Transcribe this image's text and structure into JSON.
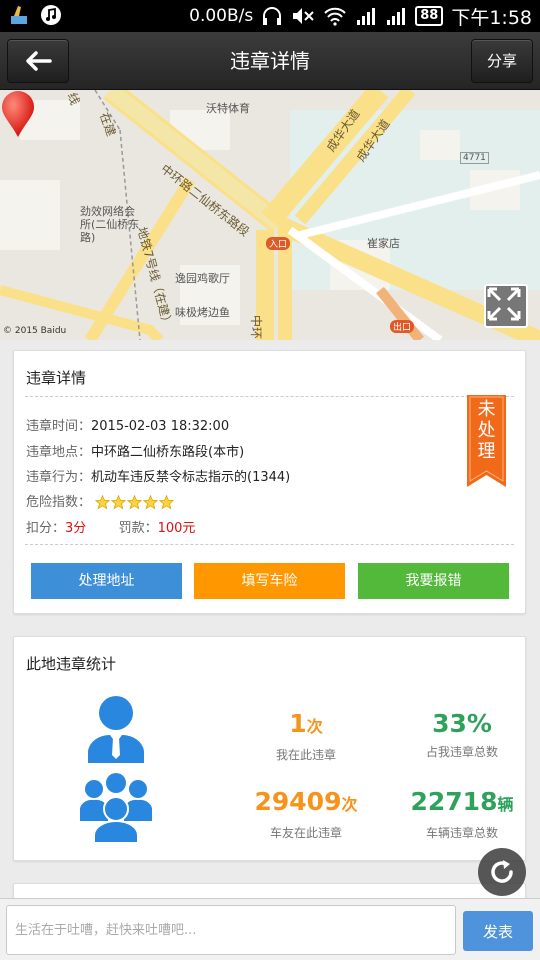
{
  "status_bar": {
    "speed": "0.00B/s",
    "battery": "88",
    "time": "下午1:58"
  },
  "header": {
    "title": "违章详情",
    "share": "分享"
  },
  "map": {
    "labels": {
      "sport": "沃特体育",
      "road_main": "中环路二仙桥东路段",
      "road_east1": "成华大道",
      "road_east2": "成华大道",
      "metro7_a": "线",
      "metro7_b": "在建",
      "metro_line": "地铁7号线（在建）",
      "service": "劲效网络会所(二仙桥东路)",
      "restaurant": "逸园鸡歌厅",
      "fish": "味极烤边鱼",
      "shop": "崔家店",
      "entrance": "入口",
      "exit": "出口",
      "road_center": "中环",
      "road_nr": "4771"
    },
    "copyright": "© 2015 Baidu"
  },
  "detail": {
    "title": "违章详情",
    "time_label": "违章时间：",
    "time_value": "2015-02-03 18:32:00",
    "place_label": "违章地点：",
    "place_value": "中环路二仙桥东路段(本市)",
    "behavior_label": "违章行为：",
    "behavior_value": "机动车违反禁令标志指示的(1344)",
    "risk_label": "危险指数：",
    "risk_stars": 5,
    "points_label": "扣分：",
    "points_value": "3分",
    "fine_label": "罚款：",
    "fine_value": "100元",
    "ribbon_text": "未处理",
    "buttons": {
      "address": "处理地址",
      "insurance": "填写车险",
      "report": "我要报错"
    }
  },
  "stats": {
    "title": "此地违章统计",
    "mine_count": "1",
    "mine_unit": "次",
    "mine_label": "我在此违章",
    "share_percent": "33%",
    "share_label": "占我违章总数",
    "friends_count": "29409",
    "friends_unit": "次",
    "friends_label": "车友在此违章",
    "vehicles_count": "22718",
    "vehicles_unit": "辆",
    "vehicles_label": "车辆违章总数"
  },
  "comment": {
    "placeholder": "生活在于吐嘈，赶快来吐嘈吧...",
    "send": "发表"
  },
  "colors": {
    "blue": "#3d8fd8",
    "orange": "#ff9700",
    "green": "#52b93a",
    "stat_orange": "#f7931a",
    "stat_green": "#2ea25a"
  }
}
